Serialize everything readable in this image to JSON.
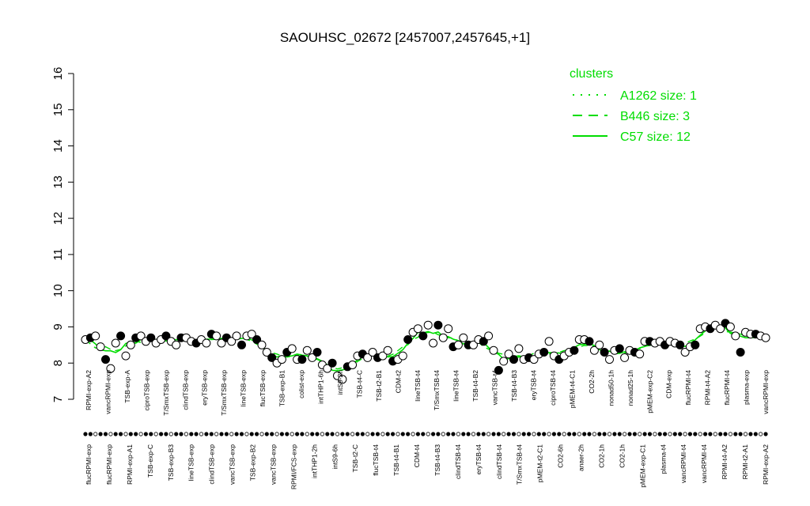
{
  "chart_data": {
    "type": "scatter",
    "title": "SAOUHSC_02672 [2457007,2457645,+1]",
    "xlabel": "",
    "ylabel": "",
    "ylim": [
      7,
      16
    ],
    "yticks": [
      7,
      8,
      9,
      10,
      11,
      12,
      13,
      14,
      15,
      16
    ],
    "legend": {
      "title": "clusters",
      "position": "top-right",
      "color": "#00dd00",
      "entries": [
        {
          "label": "A1262 size: 1",
          "style": "dotted"
        },
        {
          "label": "B446 size: 3",
          "style": "dashed"
        },
        {
          "label": "C57 size: 12",
          "style": "solid"
        }
      ]
    },
    "labels_top": [
      "RPMI-exp-A2",
      "vancRPMI-exp",
      "TSB-exp-A",
      "ciproTSB-exp",
      "T/SmxTSB-exp",
      "clindTSB-exp",
      "eryTSB-exp",
      "T/SmxTSB-exp",
      "lineTSB-exp",
      "flucTSB-exp",
      "TSB-exp-B1",
      "colist-exp",
      "intTHP1-6h",
      "intS9-2h",
      "TSB-t4-C",
      "TSB-t2-B1",
      "CDM-t2",
      "lineTSB-t4",
      "T/SmxTSB-t4",
      "lineTSB-t4",
      "TSB-t4-B2",
      "vancTSB-t4",
      "TSB-t4-B3",
      "eryTSB-t4",
      "ciproTSB-t4",
      "pMEM-t4-C1",
      "CO2-2h",
      "nonad50-1h",
      "nonad25-1h",
      "pMEM-exp-C2",
      "CDM-exp",
      "flucRPMI-t4",
      "RPMI-t4-A2",
      "flucRPMI-t4",
      "plasma-exp",
      "vancRPMI-exp"
    ],
    "labels_bottom": [
      "flucRPMI-exp",
      "flucRPMI-exp",
      "RPMI-exp-A1",
      "TSB-exp-C",
      "TSB-exp-B3",
      "lineTSB-exp",
      "clindTSB-exp",
      "vancTSB-exp",
      "TSB-exp-B2",
      "vancTSB-exp",
      "RPMI/FCS-exp",
      "intTHP1-2h",
      "intS9-6h",
      "TSB-t2-C",
      "flucTSB-t4",
      "TSB-t4-B1",
      "CDM-t4",
      "TSB-t4-B3",
      "clindTSB-t4",
      "eryTSB-t4",
      "clindTSB-t4",
      "T/SmxTSB-t4",
      "pMEM-t2-C1",
      "CO2-6h",
      "anaer-2h",
      "CO2-1h",
      "CO2-1h",
      "pMEM-exp-C1",
      "plasma-t4",
      "vancRPMI-t4",
      "vancRPMI-t4",
      "RPMI-t4-A2",
      "RPMI-t2-A1",
      "RPMI-exp-A2"
    ],
    "series": [
      {
        "values": [
          8.65,
          8.7,
          8.75,
          8.45,
          8.1,
          7.85,
          8.55,
          8.75,
          8.2,
          8.5,
          8.7,
          8.75,
          8.6,
          8.7,
          8.55,
          8.65,
          8.75,
          8.6,
          8.5,
          8.7,
          8.7,
          8.6,
          8.55,
          8.65,
          8.55,
          8.8,
          8.75,
          8.55,
          8.7,
          8.6,
          8.75,
          8.5,
          8.75,
          8.8,
          8.65,
          8.5,
          8.3,
          8.15,
          8.0,
          8.1,
          8.3,
          8.4,
          8.1,
          8.1,
          8.35,
          8.15,
          8.3,
          7.95,
          7.85,
          8.0,
          7.65,
          7.55,
          7.9,
          7.95,
          8.2,
          8.25,
          8.15,
          8.3,
          8.15,
          8.2,
          8.35,
          8.05,
          8.1,
          8.2,
          8.65,
          8.85,
          8.95,
          8.75,
          9.05,
          8.55,
          9.05,
          8.7,
          8.95,
          8.45,
          8.5,
          8.7,
          8.5,
          8.5,
          8.65,
          8.6,
          8.75,
          8.35,
          7.8,
          8.05,
          8.25,
          8.1,
          8.4,
          8.1,
          8.15,
          8.1,
          8.25,
          8.3,
          8.6,
          8.2,
          8.1,
          8.2,
          8.3,
          8.35,
          8.65,
          8.65,
          8.6,
          8.35,
          8.5,
          8.3,
          8.1,
          8.35,
          8.4,
          8.15,
          8.35,
          8.3,
          8.25,
          8.6,
          8.6,
          8.55,
          8.6,
          8.5,
          8.6,
          8.55,
          8.5,
          8.3,
          8.45,
          8.5,
          8.95,
          9.0,
          8.95,
          9.05,
          8.95,
          9.1,
          9.0,
          8.75,
          8.3,
          8.85,
          8.8,
          8.8,
          8.75,
          8.7
        ]
      }
    ]
  }
}
